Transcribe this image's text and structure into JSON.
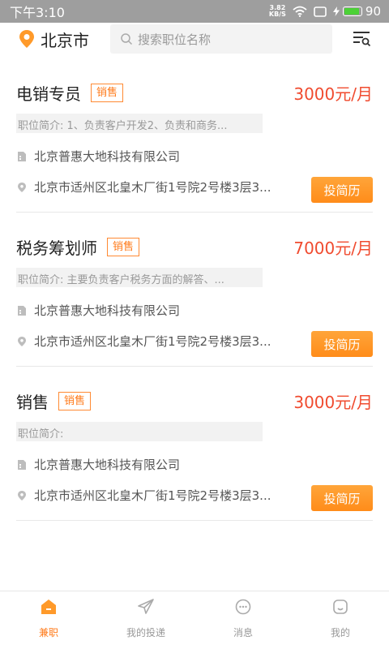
{
  "status_bar": {
    "time": "下午3:10",
    "net_speed_value": "3.82",
    "net_speed_unit": "KB/S",
    "battery_level": "90",
    "battery_color": "#4cd137",
    "bar_color": "#9e9e9e"
  },
  "header": {
    "city": "北京市",
    "search_placeholder": "搜索职位名称",
    "accent": "#ff9a2a"
  },
  "jobs": [
    {
      "title": "电销专员",
      "tag": "销售",
      "salary": "3000元/月",
      "brief": "职位简介:    1、负责客户开发2、负责和商务...",
      "company": "北京普惠大地科技有限公司",
      "address": "北京市适州区北皇木厂街1号院2号楼3层3...",
      "apply_label": "投简历"
    },
    {
      "title": "税务筹划师",
      "tag": "销售",
      "salary": "7000元/月",
      "brief": "职位简介:    主要负责客户税务方面的解答、...",
      "company": "北京普惠大地科技有限公司",
      "address": "北京市适州区北皇木厂街1号院2号楼3层3...",
      "apply_label": "投简历"
    },
    {
      "title": "销售",
      "tag": "销售",
      "salary": "3000元/月",
      "brief": "职位简介:",
      "company": "北京普惠大地科技有限公司",
      "address": "北京市适州区北皇木厂街1号院2号楼3层3...",
      "apply_label": "投简历"
    }
  ],
  "bottom_nav": [
    {
      "label": "兼职",
      "icon": "home-icon",
      "active": true
    },
    {
      "label": "我的投递",
      "icon": "send-icon",
      "active": false
    },
    {
      "label": "消息",
      "icon": "message-icon",
      "active": false
    },
    {
      "label": "我的",
      "icon": "profile-icon",
      "active": false
    }
  ],
  "colors": {
    "salary": "#f04b2f",
    "tag": "#ff7a1a",
    "button": "#ff9a2a"
  }
}
